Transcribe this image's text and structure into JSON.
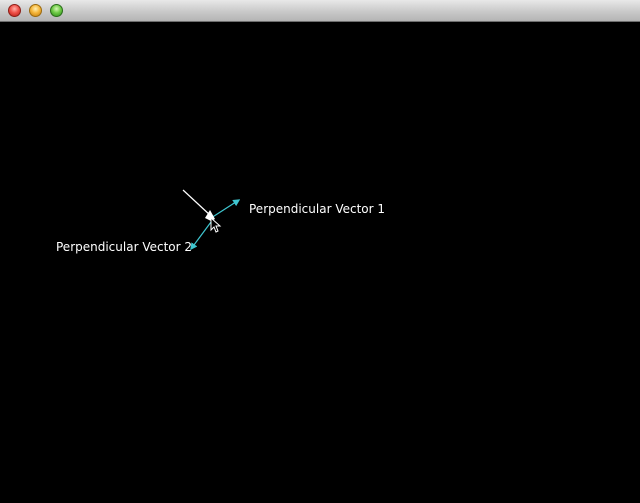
{
  "window": {
    "buttons": [
      "close",
      "minimize",
      "zoom"
    ]
  },
  "scene": {
    "labels": {
      "vector1": "Perpendicular Vector 1",
      "vector2": "Perpendicular Vector 2"
    },
    "colors": {
      "background": "#000000",
      "main_vector": "#ffffff",
      "perpendicular_vectors": "#3fc6d0",
      "label_text": "#ffffff"
    },
    "icons": {
      "cursor": "pointer-cursor-icon"
    }
  }
}
